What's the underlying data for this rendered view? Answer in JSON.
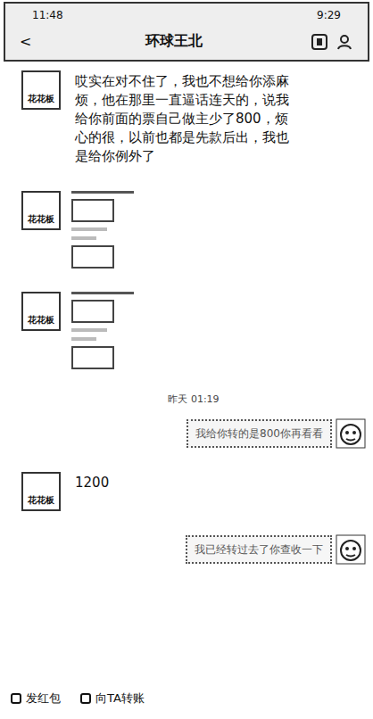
{
  "status_bar": {
    "time": "11:48",
    "right": "9:29"
  },
  "header": {
    "back": "<",
    "title": "环球王北"
  },
  "messages": [
    {
      "kind": "text",
      "side": "left",
      "avatar": "花花板",
      "text": "哎实在对不住了，我也不想给你添麻烦，他在那里一直逼话连天的，说我给你前面的票自己做主少了800，烦心的很，以前也都是先款后出，我也是给你例外了"
    },
    {
      "kind": "image",
      "side": "left",
      "avatar": "花花板",
      "text": ""
    },
    {
      "kind": "image",
      "side": "left",
      "avatar": "花花板",
      "text": ""
    },
    {
      "kind": "time",
      "side": "center",
      "avatar": "",
      "text": "昨天 01:19"
    },
    {
      "kind": "text",
      "side": "right",
      "avatar": "",
      "text": "我给你转的是800你再看看"
    },
    {
      "kind": "text",
      "side": "left",
      "avatar": "花花板",
      "text": "1200"
    },
    {
      "kind": "text",
      "side": "right",
      "avatar": "",
      "text": "我已经转过去了你查收一下"
    }
  ],
  "toolbar": [
    {
      "label": "发红包"
    },
    {
      "label": "向TA转账"
    }
  ]
}
